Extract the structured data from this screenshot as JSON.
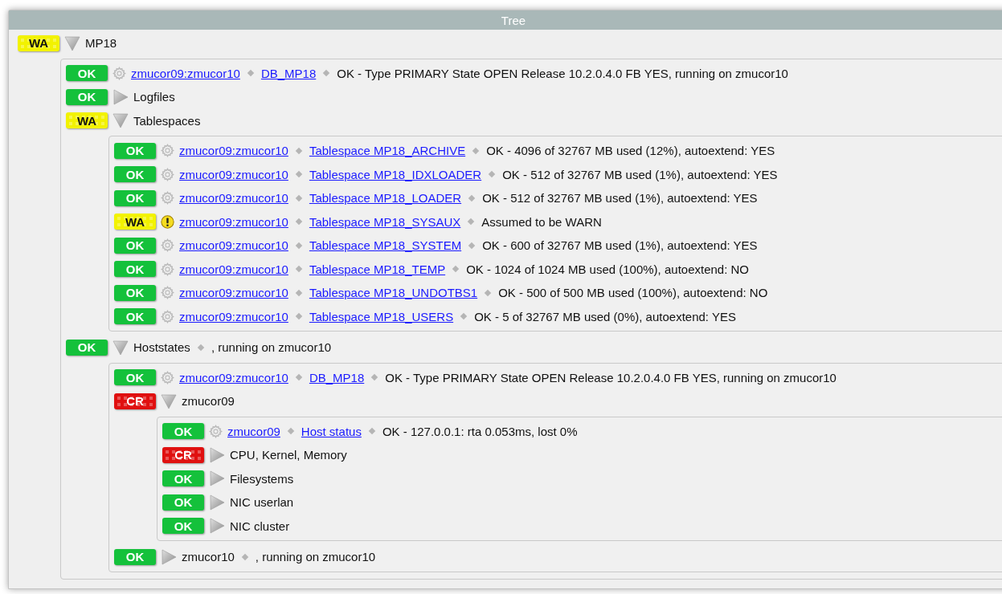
{
  "window": {
    "title": "Tree"
  },
  "tree": [
    {
      "kind": "group",
      "color": "#f2f200",
      "checkered": true,
      "badge": "WA",
      "expanded": true,
      "name": "MP18",
      "children": [
        {
          "kind": "service",
          "color": "#14c13b",
          "checkered": false,
          "warning_icon": false,
          "badge": "OK",
          "host": "zmucor09:zmucor10",
          "service": "DB_MP18",
          "output": "OK - Type PRIMARY State OPEN Release 10.2.0.4.0 FB YES, running on zmucor10"
        },
        {
          "kind": "group",
          "color": "#14c13b",
          "checkered": false,
          "badge": "OK",
          "expanded": false,
          "name": "Logfiles"
        },
        {
          "kind": "group",
          "color": "#f2f200",
          "checkered": true,
          "badge": "WA",
          "expanded": true,
          "name": "Tablespaces",
          "children": [
            {
              "kind": "service",
              "color": "#14c13b",
              "checkered": false,
              "warning_icon": false,
              "badge": "OK",
              "host": "zmucor09:zmucor10",
              "service": "Tablespace MP18_ARCHIVE",
              "output": "OK - 4096 of 32767 MB used (12%), autoextend: YES"
            },
            {
              "kind": "service",
              "color": "#14c13b",
              "checkered": false,
              "warning_icon": false,
              "badge": "OK",
              "host": "zmucor09:zmucor10",
              "service": "Tablespace MP18_IDXLOADER",
              "output": "OK - 512 of 32767 MB used (1%), autoextend: YES"
            },
            {
              "kind": "service",
              "color": "#14c13b",
              "checkered": false,
              "warning_icon": false,
              "badge": "OK",
              "host": "zmucor09:zmucor10",
              "service": "Tablespace MP18_LOADER",
              "output": "OK - 512 of 32767 MB used (1%), autoextend: YES"
            },
            {
              "kind": "service",
              "color": "#f2f200",
              "checkered": true,
              "warning_icon": true,
              "badge": "WA",
              "host": "zmucor09:zmucor10",
              "service": "Tablespace MP18_SYSAUX",
              "output": "Assumed to be WARN"
            },
            {
              "kind": "service",
              "color": "#14c13b",
              "checkered": false,
              "warning_icon": false,
              "badge": "OK",
              "host": "zmucor09:zmucor10",
              "service": "Tablespace MP18_SYSTEM",
              "output": "OK - 600 of 32767 MB used (1%), autoextend: YES"
            },
            {
              "kind": "service",
              "color": "#14c13b",
              "checkered": false,
              "warning_icon": false,
              "badge": "OK",
              "host": "zmucor09:zmucor10",
              "service": "Tablespace MP18_TEMP",
              "output": "OK - 1024 of 1024 MB used (100%), autoextend: NO"
            },
            {
              "kind": "service",
              "color": "#14c13b",
              "checkered": false,
              "warning_icon": false,
              "badge": "OK",
              "host": "zmucor09:zmucor10",
              "service": "Tablespace MP18_UNDOTBS1",
              "output": "OK - 500 of 500 MB used (100%), autoextend: NO"
            },
            {
              "kind": "service",
              "color": "#14c13b",
              "checkered": false,
              "warning_icon": false,
              "badge": "OK",
              "host": "zmucor09:zmucor10",
              "service": "Tablespace MP18_USERS",
              "output": "OK - 5 of 32767 MB used (0%), autoextend: YES"
            }
          ]
        },
        {
          "kind": "group",
          "color": "#14c13b",
          "checkered": false,
          "badge": "OK",
          "expanded": true,
          "name": "Hoststates",
          "output": ", running on zmucor10",
          "children": [
            {
              "kind": "service",
              "color": "#14c13b",
              "checkered": false,
              "warning_icon": false,
              "badge": "OK",
              "host": "zmucor09:zmucor10",
              "service": "DB_MP18",
              "output": "OK - Type PRIMARY State OPEN Release 10.2.0.4.0 FB YES, running on zmucor10"
            },
            {
              "kind": "group",
              "color": "#e01010",
              "checkered": true,
              "badge": "CR",
              "expanded": true,
              "name": "zmucor09",
              "children": [
                {
                  "kind": "service",
                  "color": "#14c13b",
                  "checkered": false,
                  "warning_icon": false,
                  "badge": "OK",
                  "host": "zmucor09",
                  "service": "Host status",
                  "output": "OK - 127.0.0.1: rta 0.053ms, lost 0%"
                },
                {
                  "kind": "group",
                  "color": "#e01010",
                  "checkered": true,
                  "badge": "CR",
                  "expanded": false,
                  "name": "CPU, Kernel, Memory"
                },
                {
                  "kind": "group",
                  "color": "#14c13b",
                  "checkered": false,
                  "badge": "OK",
                  "expanded": false,
                  "name": "Filesystems"
                },
                {
                  "kind": "group",
                  "color": "#14c13b",
                  "checkered": false,
                  "badge": "OK",
                  "expanded": false,
                  "name": "NIC userlan"
                },
                {
                  "kind": "group",
                  "color": "#14c13b",
                  "checkered": false,
                  "badge": "OK",
                  "expanded": false,
                  "name": "NIC cluster"
                }
              ]
            },
            {
              "kind": "group",
              "color": "#14c13b",
              "checkered": false,
              "badge": "OK",
              "expanded": false,
              "name": "zmucor10",
              "output": ", running on zmucor10"
            }
          ]
        }
      ]
    }
  ]
}
